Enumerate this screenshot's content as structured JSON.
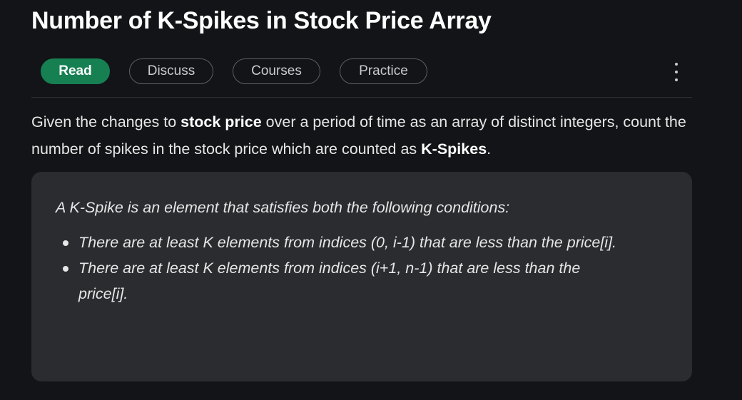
{
  "article": {
    "title": "Number of K-Spikes in Stock Price Array"
  },
  "tabs": [
    {
      "label": "Read",
      "active": true
    },
    {
      "label": "Discuss",
      "active": false
    },
    {
      "label": "Courses",
      "active": false
    },
    {
      "label": "Practice",
      "active": false
    }
  ],
  "menu": {
    "icon": "more-vertical-icon"
  },
  "intro": {
    "part1": "Given the changes to ",
    "bold1": "stock price",
    "part2": " over a period of time as an array of distinct integers, count the number of spikes in the stock price which are counted as ",
    "bold2": "K-Spikes",
    "part3": "."
  },
  "note": {
    "lead": "A K-Spike is an element that satisfies both the following conditions:",
    "conditions": [
      "There are at least K elements from indices (0, i-1) that are less than the price[i].",
      "There are at least K elements from indices (i+1, n-1) that are less than the price[i]."
    ]
  },
  "colors": {
    "background": "#131417",
    "accent": "#168053",
    "card": "#2b2c30"
  }
}
